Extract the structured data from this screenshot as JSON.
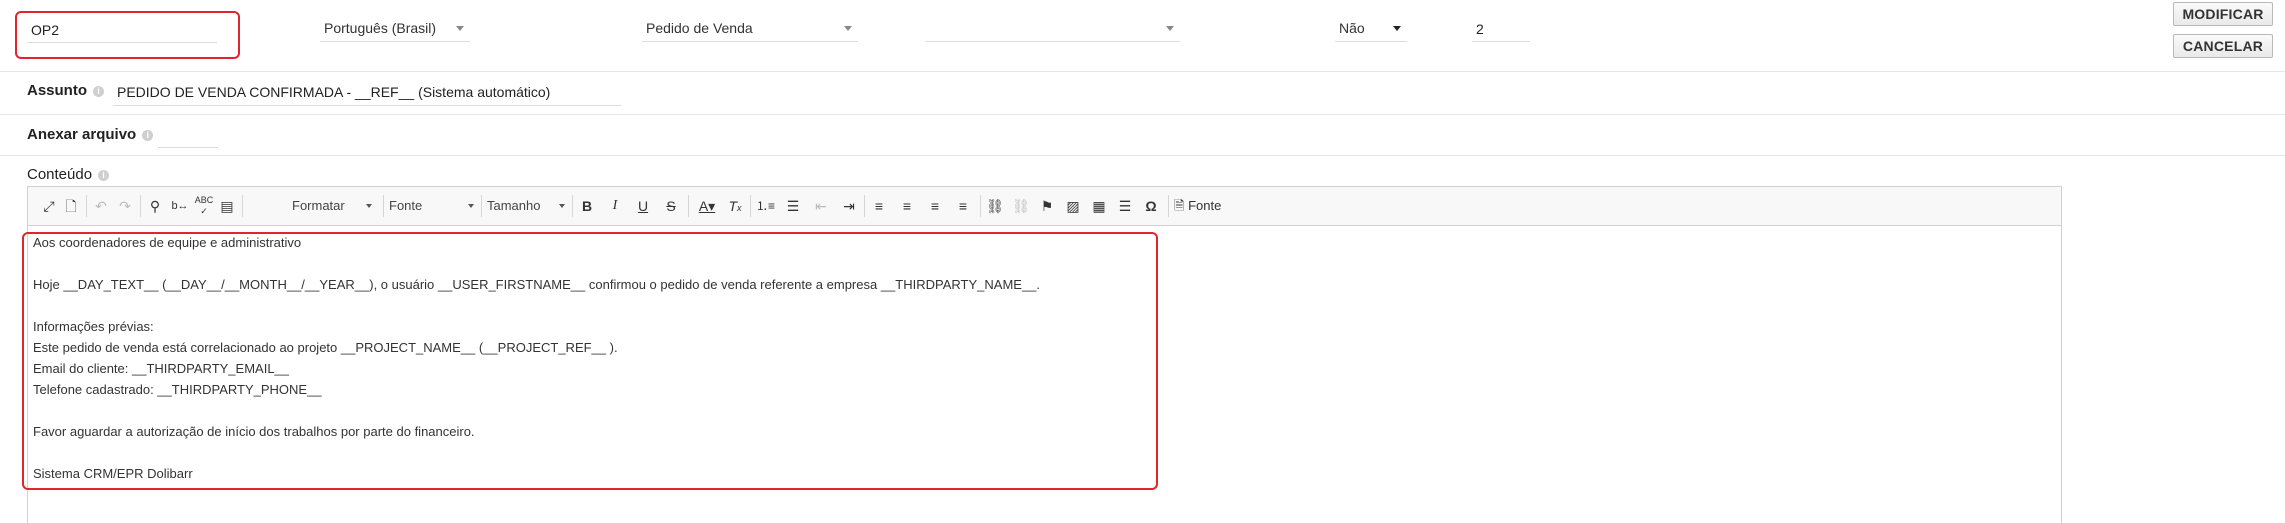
{
  "top_row": {
    "code_value": "OP2",
    "language": "Português (Brasil)",
    "type": "Pedido de Venda",
    "blank_select": "",
    "yes_no": "Não",
    "position_value": "2"
  },
  "buttons": {
    "modify": "MODIFICAR",
    "cancel": "CANCELAR"
  },
  "subject": {
    "label": "Assunto",
    "value": "PEDIDO DE VENDA CONFIRMADA - __REF__ (Sistema automático)"
  },
  "attach": {
    "label": "Anexar arquivo"
  },
  "content": {
    "label": "Conteúdo"
  },
  "toolbar": {
    "format_label": "Formatar",
    "font_label": "Fonte",
    "size_label": "Tamanho",
    "source_label": "Fonte"
  },
  "body_lines": [
    "Aos coordenadores de equipe e administrativo",
    "",
    "Hoje __DAY_TEXT__ (__DAY__/__MONTH__/__YEAR__), o usuário __USER_FIRSTNAME__ confirmou o pedido de venda referente a empresa __THIRDPARTY_NAME__.",
    "",
    "Informações prévias:",
    "Este pedido de venda está correlacionado ao projeto __PROJECT_NAME__ (__PROJECT_REF__ ).",
    "Email do cliente: __THIRDPARTY_EMAIL__",
    "Telefone cadastrado: __THIRDPARTY_PHONE__",
    "",
    "Favor aguardar a autorização de início dos trabalhos por parte do financeiro.",
    "",
    "Sistema CRM/EPR Dolibarr"
  ],
  "colors": {
    "highlight": "#e0252c",
    "border": "#d1d1d1"
  }
}
